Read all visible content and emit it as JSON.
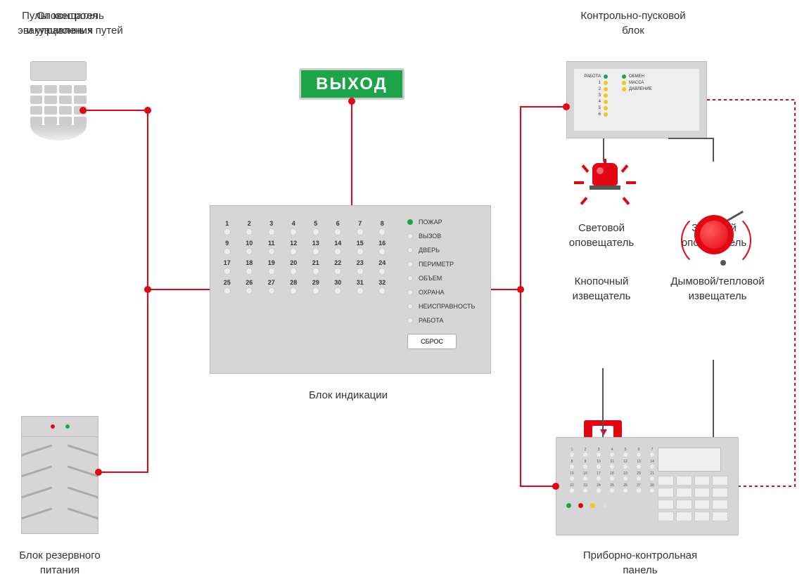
{
  "labels": {
    "keypad": "Пульт контроля\nи управления",
    "exit": "Оповещатель\nэвакуационных путей",
    "clb": "Контрольно-пусковой\nблок",
    "ind": "Блок индикации",
    "ups": "Блок резервного\nпитания",
    "light": "Световой\nоповещатель",
    "sound": "Звуковой\nоповещатель",
    "callpoint": "Кнопочный\nизвещатель",
    "smoke": "Дымовой/тепловой\nизвещатель",
    "panel": "Приборно-контрольная\nпанель"
  },
  "exit_text": "ВЫХОД",
  "clb": {
    "left": [
      {
        "t": "РАБОТА",
        "c": "dg"
      },
      {
        "t": "1",
        "c": "dy"
      },
      {
        "t": "2",
        "c": "dy"
      },
      {
        "t": "3",
        "c": "dy"
      },
      {
        "t": "4",
        "c": "dy"
      },
      {
        "t": "5",
        "c": "dy"
      },
      {
        "t": "6",
        "c": "dy"
      }
    ],
    "right": [
      {
        "t": "ОБМЕН",
        "c": "dg"
      },
      {
        "t": "МАССА",
        "c": "dy"
      },
      {
        "t": "ДАВЛЕНИЕ",
        "c": "dy"
      }
    ]
  },
  "ind": {
    "zones": 32,
    "status": [
      {
        "t": "ПОЖАР",
        "g": true
      },
      {
        "t": "ВЫЗОВ"
      },
      {
        "t": "ДВЕРЬ"
      },
      {
        "t": "ПЕРИМЕТР"
      },
      {
        "t": "ОБЪЕМ"
      },
      {
        "t": "ОХРАНА"
      },
      {
        "t": "НЕИСПРАВНОСТЬ"
      },
      {
        "t": "РАБОТА"
      }
    ],
    "reset": "СБРОС"
  },
  "panel": {
    "zones": 28,
    "leds": [
      "#1BA548",
      "#E30613",
      "#F5C518",
      "#ddd"
    ]
  }
}
